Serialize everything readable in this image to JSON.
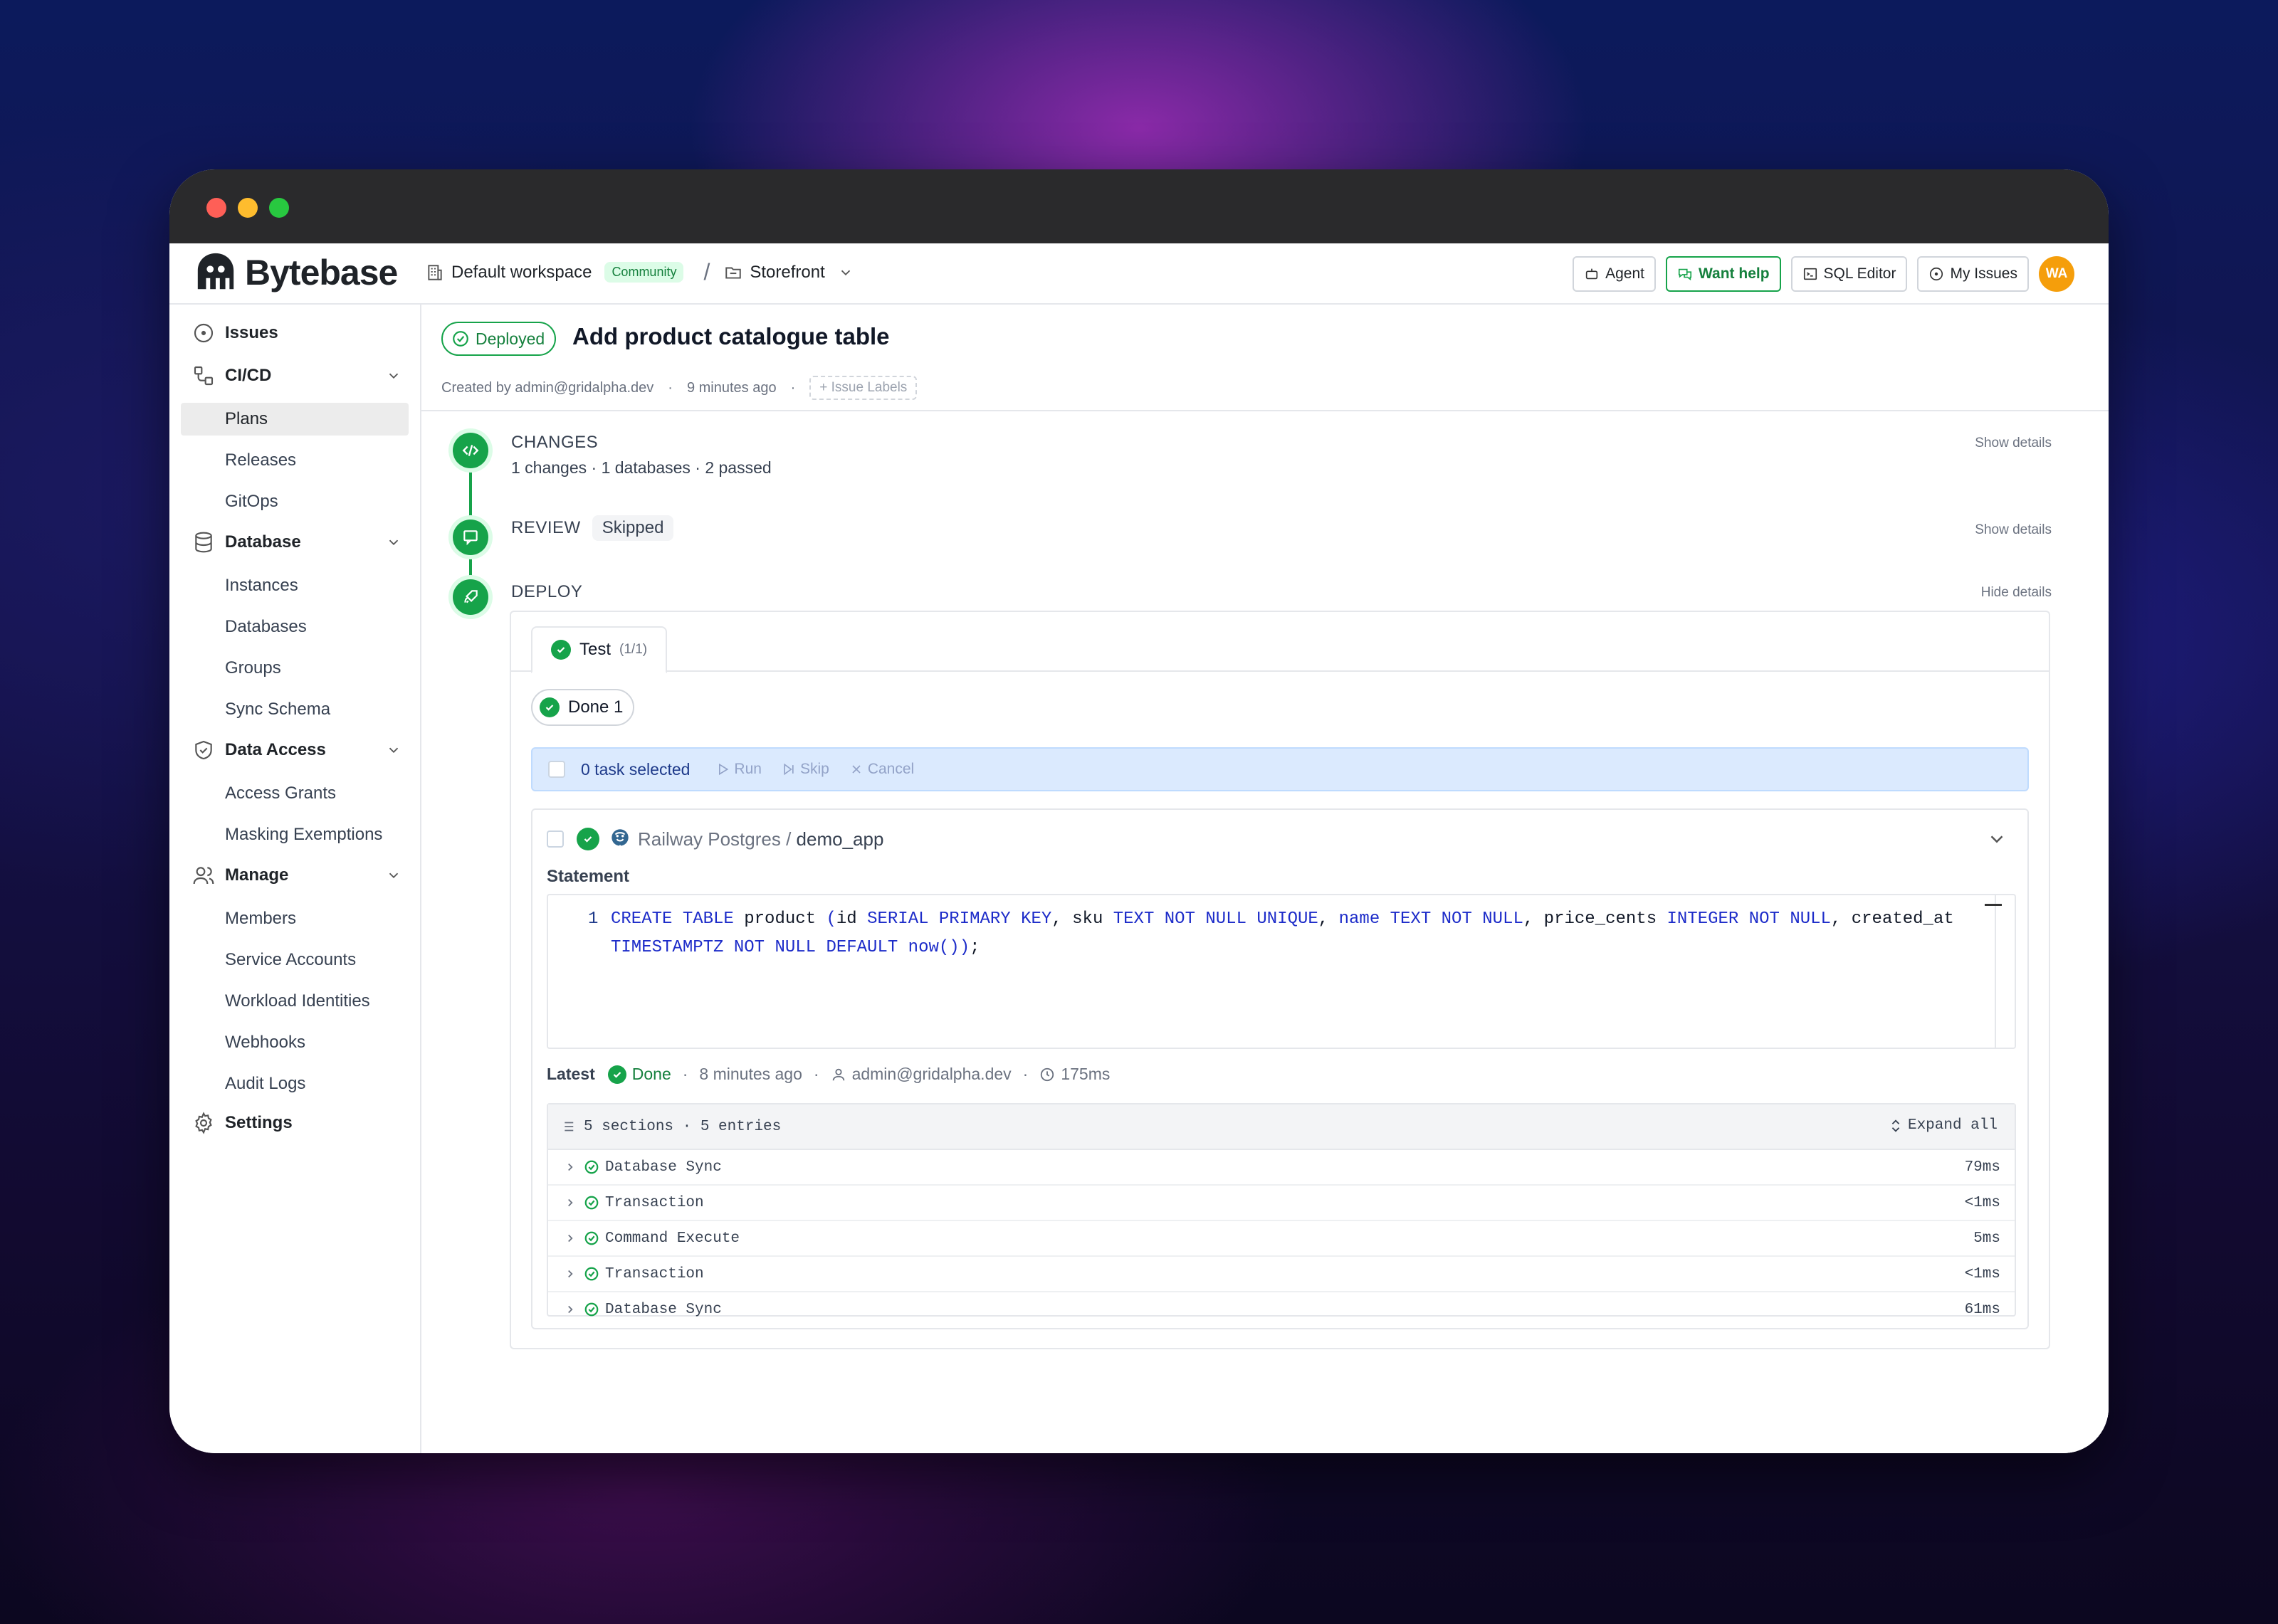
{
  "app": {
    "brand": "Bytebase",
    "workspace": "Default workspace",
    "plan_badge": "Community",
    "separator": "/",
    "project": "Storefront",
    "actions": {
      "agent": "Agent",
      "want_help": "Want help",
      "sql_editor": "SQL Editor",
      "my_issues": "My Issues",
      "avatar": "WA"
    }
  },
  "sidebar": {
    "issues": "Issues",
    "cicd": "CI/CD",
    "cicd_items": [
      "Plans",
      "Releases",
      "GitOps"
    ],
    "database": "Database",
    "database_items": [
      "Instances",
      "Databases",
      "Groups",
      "Sync Schema"
    ],
    "data_access": "Data Access",
    "data_access_items": [
      "Access Grants",
      "Masking Exemptions"
    ],
    "manage": "Manage",
    "manage_items": [
      "Members",
      "Service Accounts",
      "Workload Identities",
      "Webhooks",
      "Audit Logs"
    ],
    "settings": "Settings"
  },
  "issue": {
    "status": "Deployed",
    "title": "Add product catalogue table",
    "created_by": "Created by admin@gridalpha.dev",
    "dot": "·",
    "created_ago": "9 minutes ago",
    "labels_button": "+ Issue Labels"
  },
  "steps": {
    "changes": {
      "title": "CHANGES",
      "summary": "1 changes · 1 databases · 2 passed",
      "action": "Show details"
    },
    "review": {
      "title": "REVIEW",
      "tag": "Skipped",
      "action": "Show details"
    },
    "deploy": {
      "title": "DEPLOY",
      "action": "Hide details"
    }
  },
  "deploy": {
    "tab_label": "Test",
    "tab_count": "(1/1)",
    "done_chip": "Done 1",
    "bulk": {
      "label": "0 task selected",
      "run": "Run",
      "skip": "Skip",
      "cancel": "Cancel"
    },
    "task": {
      "instance": "Railway Postgres",
      "separator": " / ",
      "database": "demo_app",
      "statement_label": "Statement",
      "line_number": "1"
    },
    "latest": {
      "label": "Latest",
      "status": "Done",
      "ago": "8 minutes ago",
      "user": "admin@gridalpha.dev",
      "duration": "175ms",
      "dot": "·"
    },
    "log": {
      "summary": "5 sections · 5 entries",
      "expand_all": "Expand all",
      "rows": [
        {
          "name": "Database Sync",
          "duration": "79ms"
        },
        {
          "name": "Transaction",
          "duration": "<1ms"
        },
        {
          "name": "Command Execute",
          "duration": "5ms"
        },
        {
          "name": "Transaction",
          "duration": "<1ms"
        },
        {
          "name": "Database Sync",
          "duration": "61ms"
        }
      ]
    }
  },
  "sql": {
    "t01": "CREATE TABLE",
    "t02": " product ",
    "t03": "(",
    "t04": "id ",
    "t05": "SERIAL PRIMARY KEY",
    "t06": ", sku ",
    "t07": "TEXT NOT NULL UNIQUE",
    "t08": ", ",
    "t09": "name",
    "t10": " ",
    "t11": "TEXT NOT NULL",
    "t12": ", price_cents ",
    "t13": "INTEGER NOT NULL",
    "t14": ", created_at ",
    "t15": "TIMESTAMPTZ NOT NULL DEFAULT",
    "t16": " ",
    "t17": "now",
    "t18": "())",
    "t19": ";"
  },
  "colors": {
    "accent_green": "#16a34a",
    "keyword_blue": "#1d2cc9",
    "bulk_bar": "#dbeafe",
    "avatar": "#f59e0b"
  }
}
